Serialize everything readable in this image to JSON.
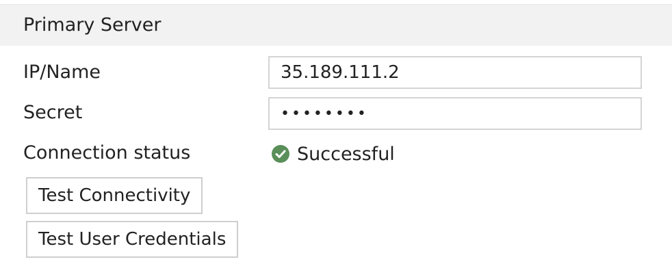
{
  "section": {
    "title": "Primary Server"
  },
  "fields": {
    "ip_name": {
      "label": "IP/Name",
      "value": "35.189.111.2"
    },
    "secret": {
      "label": "Secret",
      "value": "••••••••"
    }
  },
  "connection": {
    "label": "Connection status",
    "status_text": "Successful",
    "status_icon": "check-circle-icon",
    "status_color": "#5a8f5a"
  },
  "buttons": {
    "test_connectivity": "Test Connectivity",
    "test_user_credentials": "Test User Credentials"
  }
}
